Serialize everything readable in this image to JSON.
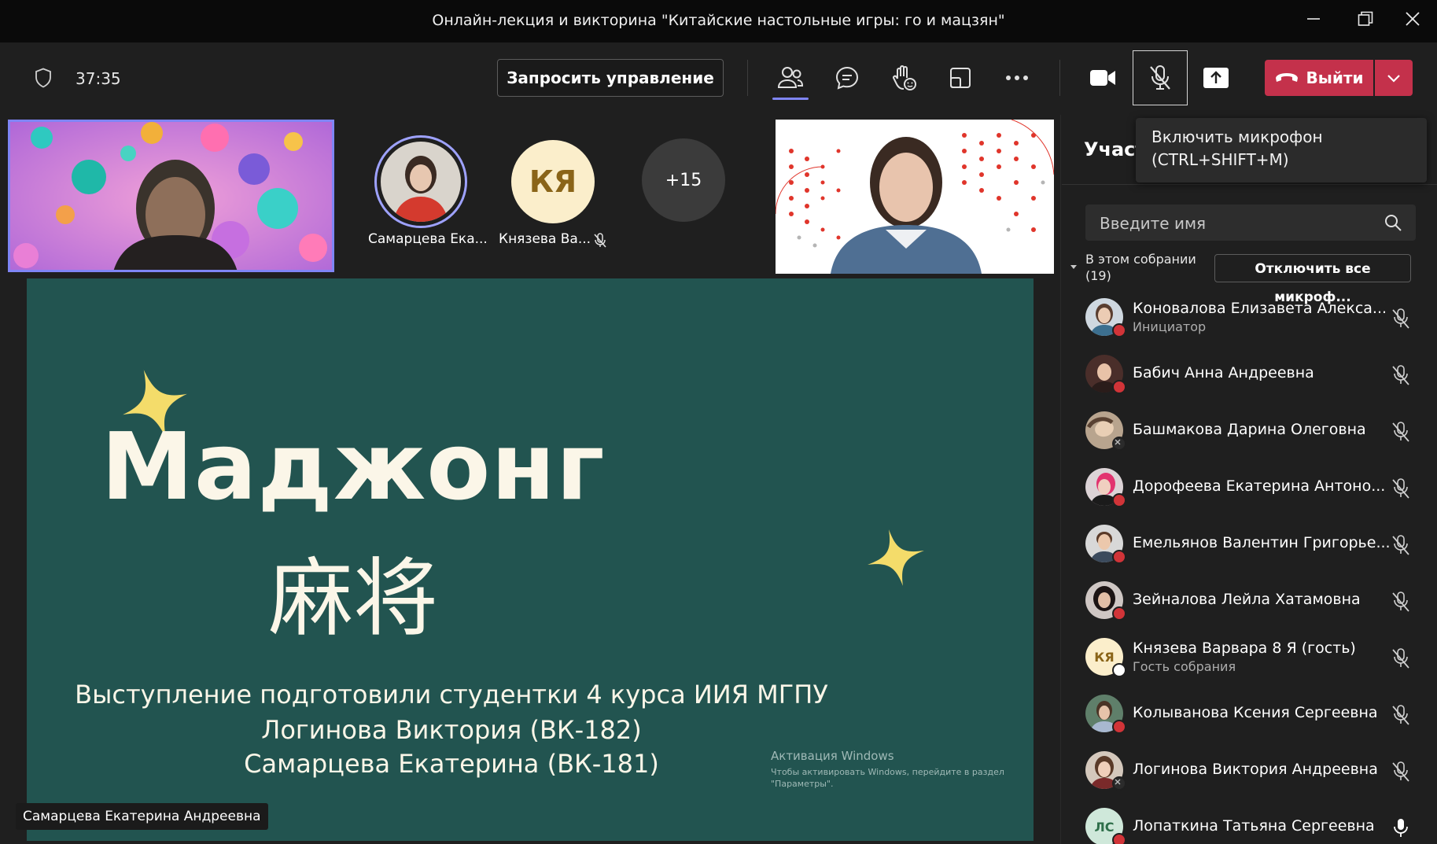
{
  "window": {
    "title": "Онлайн-лекция и викторина \"Китайские настольные игры: го и мацзян\""
  },
  "toolbar": {
    "timer": "37:35",
    "request_control": "Запросить управление",
    "leave_label": "Выйти",
    "tooltip_line1": "Включить микрофон",
    "tooltip_line2": "(CTRL+SHIFT+M)"
  },
  "gallery": {
    "tiles": [
      {
        "name": "Самарцева Ека...",
        "type": "photo"
      },
      {
        "name": "Князева Ва...",
        "initials": "КЯ",
        "muted": true
      },
      {
        "overflow": "+15"
      }
    ]
  },
  "slide": {
    "title": "Маджонг",
    "hanzi": "麻将",
    "line1": "Выступление подготовили студентки 4 курса ИИЯ МГПУ",
    "line2": "Логинова Виктория (ВК-182)",
    "line3": "Самарцева Екатерина (ВК-181)",
    "watermark_title": "Активация Windows",
    "watermark_text": "Чтобы активировать Windows, перейдите в раздел \"Параметры\"."
  },
  "speaker_label": "Самарцева Екатерина Андреевна",
  "panel": {
    "title": "Участ",
    "search_placeholder": "Введите имя",
    "section_label": "В этом собрании (19)",
    "mute_all": "Отключить все микроф...",
    "participants": [
      {
        "name": "Коновалова Елизавета Алекса...",
        "role": "Инициатор",
        "badge": "red",
        "mic": "muted"
      },
      {
        "name": "Бабич Анна Андреевна",
        "badge": "red",
        "mic": "muted"
      },
      {
        "name": "Башмакова Дарина Олеговна",
        "badge": "gray",
        "mic": "muted"
      },
      {
        "name": "Дорофеева Екатерина Антоно...",
        "badge": "red",
        "mic": "muted"
      },
      {
        "name": "Емельянов Валентин Григорье...",
        "badge": "red",
        "mic": "muted"
      },
      {
        "name": "Зейналова Лейла Хатамовна",
        "badge": "red",
        "mic": "muted"
      },
      {
        "name": "Князева Варвара 8 Я (гость)",
        "role": "Гость собрания",
        "initials": "КЯ",
        "badge": "white",
        "mic": "muted"
      },
      {
        "name": "Колыванова Ксения Сергеевна",
        "badge": "red",
        "mic": "muted"
      },
      {
        "name": "Логинова Виктория Андреевна",
        "badge": "gray",
        "mic": "muted"
      },
      {
        "name": "Лопаткина Татьяна Сергеевна",
        "initials": "ЛС",
        "badge": "red",
        "mic": "on"
      }
    ]
  },
  "colors": {
    "accent": "#7f85f5",
    "leave": "#c4314b",
    "slide_bg": "#225450",
    "star": "#f4dc6a"
  }
}
